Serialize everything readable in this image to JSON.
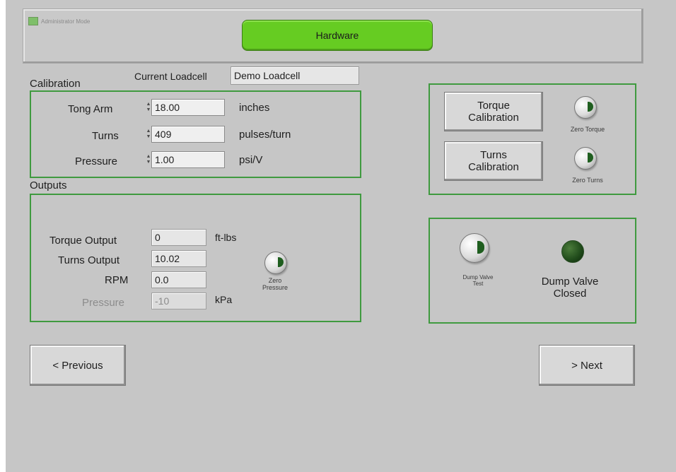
{
  "header": {
    "admin_mode_label": "Administrator Mode",
    "title": "Hardware"
  },
  "calibration": {
    "title": "Calibration",
    "current_loadcell_label": "Current Loadcell",
    "current_loadcell_value": "Demo Loadcell",
    "rows": [
      {
        "label": "Tong Arm",
        "value": "18.00",
        "unit": "inches"
      },
      {
        "label": "Turns",
        "value": "409",
        "unit": "pulses/turn"
      },
      {
        "label": "Pressure",
        "value": "1.00",
        "unit": "psi/V"
      }
    ]
  },
  "outputs": {
    "title": "Outputs",
    "rows": [
      {
        "label": "Torque Output",
        "value": "0",
        "unit": "ft-lbs"
      },
      {
        "label": "Turns Output",
        "value": "10.02",
        "unit": ""
      },
      {
        "label": "RPM",
        "value": "0.0",
        "unit": ""
      },
      {
        "label": "Pressure",
        "value": "-10",
        "unit": "kPa"
      }
    ],
    "zero_pressure_label": "Zero\nPressure"
  },
  "right_panel": {
    "torque_cal_button": "Torque\nCalibration",
    "zero_torque_label": "Zero Torque",
    "turns_cal_button": "Turns\nCalibration",
    "zero_turns_label": "Zero Turns"
  },
  "dump_valve": {
    "test_label": "Dump Valve\nTest",
    "status_text": "Dump Valve\nClosed"
  },
  "nav": {
    "previous_label": "<   Previous",
    "next_label": ">   Next"
  }
}
